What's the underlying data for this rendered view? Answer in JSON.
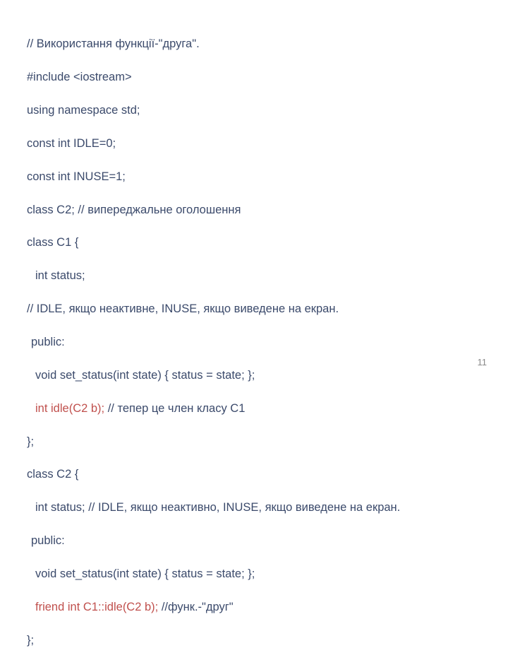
{
  "code": {
    "l1": "// Використання функції-\"друга\".",
    "l2": "#include <iostream>",
    "l3": "using namespace std;",
    "l4": "const int IDLE=0;",
    "l5": "const int INUSE=1;",
    "l6": "class C2; // випереджальне оголошення",
    "l7": "class C1 {",
    "l8": "int status;",
    "l9": "// IDLE, якщо неактивне, INUSE, якщо виведене на екран.",
    "l10": "public:",
    "l11": "void set_status(int state) { status = state; };",
    "l12a": "int idle(C2 b);",
    "l12b": " // тепер це член класу C1",
    "l13": "};",
    "l14": "class C2 {",
    "l15": "int status; // IDLE, якщо неактивно, INUSE, якщо виведене на екран.",
    "l16": "public:",
    "l17": "void set_status(int state) { status = state; };",
    "l18a": "friend int C1::idle(C2 b);",
    "l18b": " //функ.-\"друг\"",
    "l19": "};"
  },
  "slide_number": "11"
}
